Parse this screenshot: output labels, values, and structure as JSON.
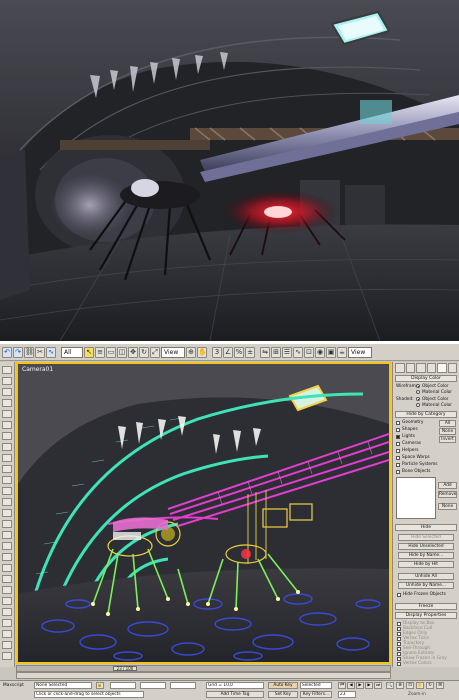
{
  "render": {},
  "toolbar": {
    "selection_filter": "All",
    "ref_coord": "View",
    "named_selection": "View"
  },
  "viewport": {
    "label": "Camera01"
  },
  "command_panel": {
    "display_color": {
      "header": "Display Color",
      "wireframe_label": "Wireframe:",
      "shaded_label": "Shaded:",
      "object_color": "Object Color",
      "material_color": "Material Color"
    },
    "hide_by_category": {
      "header": "Hide by Category",
      "items": [
        {
          "label": "Geometry",
          "checked": false
        },
        {
          "label": "Shapes",
          "checked": false
        },
        {
          "label": "Lights",
          "checked": true
        },
        {
          "label": "Cameras",
          "checked": false
        },
        {
          "label": "Helpers",
          "checked": false
        },
        {
          "label": "Space Warps",
          "checked": false
        },
        {
          "label": "Particle Systems",
          "checked": false
        },
        {
          "label": "Bone Objects",
          "checked": false
        }
      ],
      "all_button": "All",
      "none_button": "None",
      "invert_button": "Invert",
      "add_button": "Add",
      "remove_button": "Remove",
      "none2_button": "None"
    },
    "hide": {
      "header": "Hide",
      "hide_selected": "Hide Selected",
      "hide_unselected": "Hide Unselected",
      "hide_by_name": "Hide by Name...",
      "hide_by_hit": "Hide by Hit",
      "unhide_all": "Unhide All",
      "unhide_by_name": "Unhide by Name...",
      "hide_frozen": "Hide Frozen Objects"
    },
    "freeze": {
      "header": "Freeze"
    },
    "display_properties": {
      "header": "Display Properties",
      "items": [
        "Display as Box",
        "Backface Cull",
        "Edges Only",
        "Vertex Ticks",
        "Trajectory",
        "See-Through",
        "Ignore Extents",
        "Show Frozen in Gray",
        "Vertex Colors"
      ]
    }
  },
  "timeline": {
    "frame_readout": "23 / 100"
  },
  "status": {
    "selection": "None Selected",
    "prompt": "Click or click-and-drag to select objects",
    "maxscript": "Maxscript",
    "grid": "Grid = 10,0",
    "add_time_tag": "Add Time Tag",
    "auto_key": "Auto Key",
    "set_key_mode": "Selected",
    "set_key": "Set Key",
    "key_filters": "Key Filters...",
    "current_frame": "23",
    "watermark": "Zoom-in"
  },
  "colors": {
    "viewport_border": "#f0c419",
    "wire_teal": "#3ee3b8",
    "wire_magenta": "#e13ecf",
    "wire_green": "#7cf05a",
    "wire_blue": "#3a4ee8",
    "light_glow": "#ff3344"
  }
}
